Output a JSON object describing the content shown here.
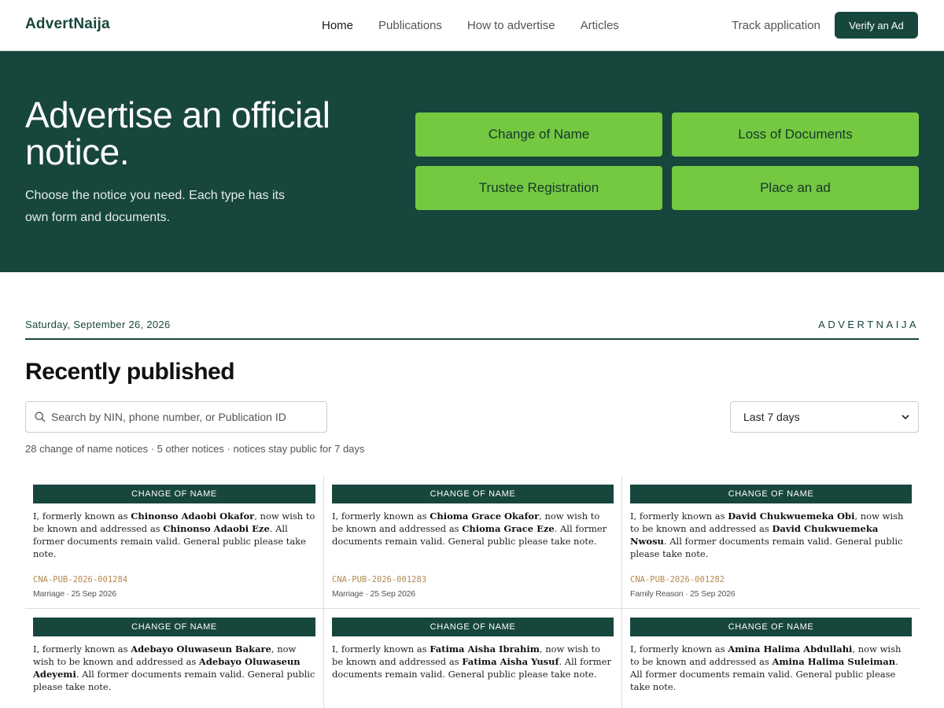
{
  "header": {
    "brand": "AdvertNaija",
    "nav": [
      "Home",
      "Publications",
      "How to advertise",
      "Articles"
    ],
    "track": "Track application",
    "verify": "Verify an Ad"
  },
  "hero": {
    "title": "Advertise an official notice.",
    "subtitle": "Choose the notice you need. Each type has its own form and documents.",
    "buttons": [
      "Change of Name",
      "Loss of Documents",
      "Trustee Registration",
      "Place an ad"
    ]
  },
  "strip": {
    "date": "Saturday, September 26, 2026",
    "masthead": "ADVERTNAIJA"
  },
  "recent": {
    "title": "Recently published",
    "search_placeholder": "Search by NIN, phone number, or Publication ID",
    "range": "Last 7 days",
    "counts": "28 change of name notices · 5 other notices · notices stay public for 7 days"
  },
  "notices": [
    {
      "tag": "CHANGE OF NAME",
      "pre": "I, formerly known as ",
      "old": "Chinonso Adaobi Okafor",
      "mid": ", now wish to be known and addressed as ",
      "new": "Chinonso Adaobi Eze",
      "post": ". All former documents remain valid. General public please take note.",
      "id": "CNA-PUB-2026-001284",
      "meta": "Marriage · 25 Sep 2026"
    },
    {
      "tag": "CHANGE OF NAME",
      "pre": "I, formerly known as ",
      "old": "Chioma Grace Okafor",
      "mid": ", now wish to be known and addressed as ",
      "new": "Chioma Grace Eze",
      "post": ". All former documents remain valid. General public please take note.",
      "id": "CNA-PUB-2026-001283",
      "meta": "Marriage · 25 Sep 2026"
    },
    {
      "tag": "CHANGE OF NAME",
      "pre": "I, formerly known as ",
      "old": "David Chukwuemeka Obi",
      "mid": ", now wish to be known and addressed as ",
      "new": "David Chukwuemeka Nwosu",
      "post": ". All former documents remain valid. General public please take note.",
      "id": "CNA-PUB-2026-001282",
      "meta": "Family Reason · 25 Sep 2026"
    },
    {
      "tag": "CHANGE OF NAME",
      "pre": "I, formerly known as ",
      "old": "Adebayo Oluwaseun Bakare",
      "mid": ", now wish to be known and addressed as ",
      "new": "Adebayo Oluwaseun Adeyemi",
      "post": ". All former documents remain valid. General public please take note."
    },
    {
      "tag": "CHANGE OF NAME",
      "pre": "I, formerly known as ",
      "old": "Fatima Aisha Ibrahim",
      "mid": ", now wish to be known and addressed as ",
      "new": "Fatima Aisha Yusuf",
      "post": ". All former documents remain valid. General public please take note."
    },
    {
      "tag": "CHANGE OF NAME",
      "pre": "I, formerly known as ",
      "old": "Amina Halima Abdullahi",
      "mid": ", now wish to be known and addressed as ",
      "new": "Amina Halima Suleiman",
      "post": ". All former documents remain valid. General public please take note."
    }
  ]
}
